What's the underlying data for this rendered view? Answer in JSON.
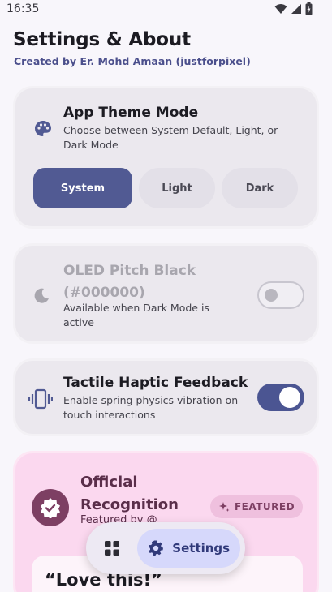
{
  "status": {
    "time": "16:35"
  },
  "header": {
    "title": "Settings & About",
    "subtitle": "Created by Er. Mohd Amaan (justforpixel)"
  },
  "theme": {
    "title": "App Theme Mode",
    "description": "Choose between System Default, Light, or Dark Mode",
    "options": [
      "System",
      "Light",
      "Dark"
    ],
    "selected": "System"
  },
  "oled": {
    "title": "OLED Pitch Black (#000000)",
    "description": "Available when Dark Mode is active",
    "enabled": false,
    "disabled": true
  },
  "haptic": {
    "title": "Tactile Haptic Feedback",
    "description": "Enable spring physics vibration on touch interactions",
    "enabled": true
  },
  "recognition": {
    "title": "Official Recognition",
    "subtitle": "Featured by @",
    "chip": "FEATURED",
    "quote": "“Love this!”"
  },
  "nav": {
    "settings_label": "Settings"
  },
  "colors": {
    "accent": "#515a93",
    "recognition_bg": "#fbd8ef",
    "recognition_accent": "#7d3f63"
  }
}
